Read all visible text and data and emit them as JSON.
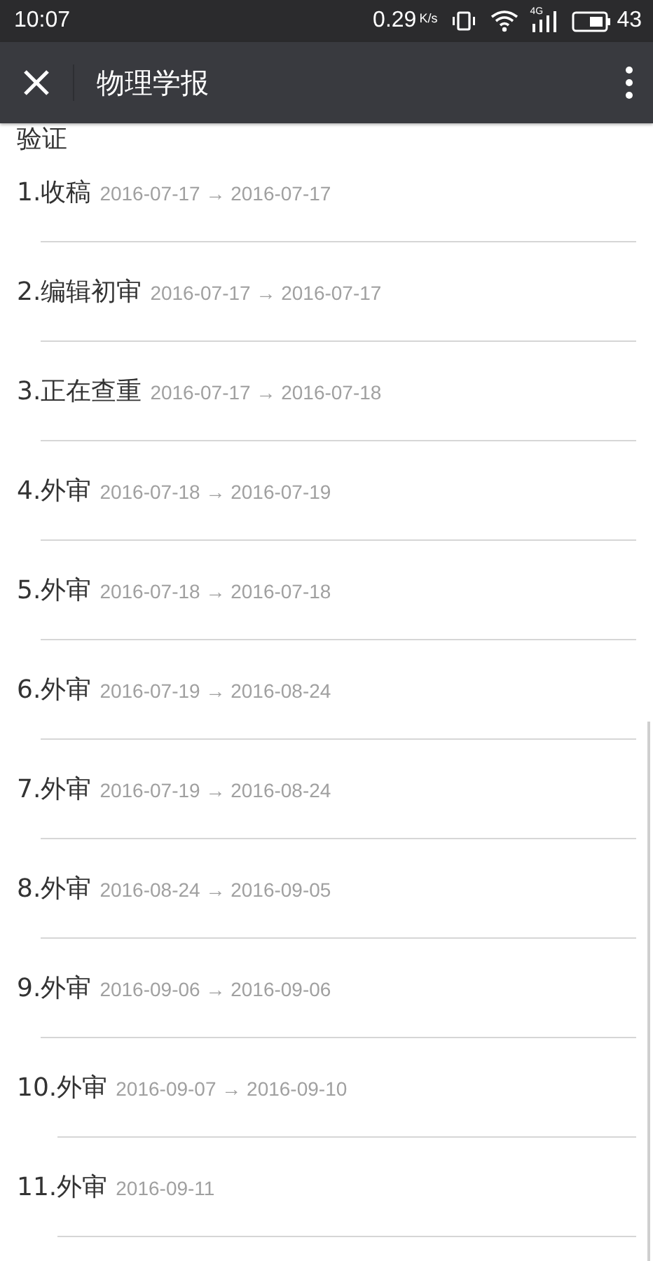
{
  "status_bar": {
    "time": "10:07",
    "speed": "0.29",
    "speed_unit": "K/s",
    "network": "4G",
    "battery_level": "43"
  },
  "toolbar": {
    "title": "物理学报"
  },
  "section_heading": "验证",
  "steps": [
    {
      "number": "1.",
      "title": "收稿",
      "dates": "2016-07-17 → 2016-07-17"
    },
    {
      "number": "2.",
      "title": "编辑初审",
      "dates": "2016-07-17 → 2016-07-17"
    },
    {
      "number": "3.",
      "title": "正在查重",
      "dates": "2016-07-17 → 2016-07-18"
    },
    {
      "number": "4.",
      "title": "外审",
      "dates": "2016-07-18 → 2016-07-19"
    },
    {
      "number": "5.",
      "title": "外审",
      "dates": "2016-07-18 → 2016-07-18"
    },
    {
      "number": "6.",
      "title": "外审",
      "dates": "2016-07-19 → 2016-08-24"
    },
    {
      "number": "7.",
      "title": "外审",
      "dates": "2016-07-19 → 2016-08-24"
    },
    {
      "number": "8.",
      "title": "外审",
      "dates": "2016-08-24 → 2016-09-05"
    },
    {
      "number": "9.",
      "title": "外审",
      "dates": "2016-09-06 → 2016-09-06"
    },
    {
      "number": "10.",
      "title": "外审",
      "dates": "2016-09-07 → 2016-09-10"
    },
    {
      "number": "11.",
      "title": "外审",
      "dates": "2016-09-11"
    }
  ]
}
